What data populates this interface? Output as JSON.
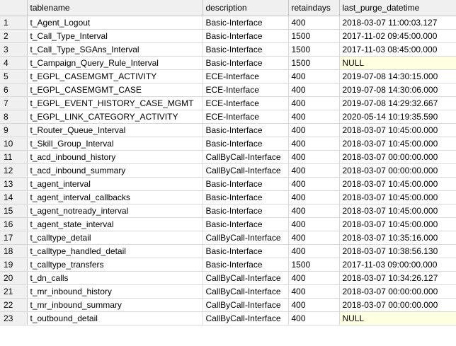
{
  "grid": {
    "columns": [
      "tablename",
      "description",
      "retaindays",
      "last_purge_datetime"
    ],
    "rows": [
      {
        "n": "1",
        "tablename": "t_Agent_Logout",
        "description": "Basic-Interface",
        "retaindays": "400",
        "last_purge_datetime": "2018-03-07 11:00:03.127"
      },
      {
        "n": "2",
        "tablename": "t_Call_Type_Interval",
        "description": "Basic-Interface",
        "retaindays": "1500",
        "last_purge_datetime": "2017-11-02 09:45:00.000"
      },
      {
        "n": "3",
        "tablename": "t_Call_Type_SGAns_Interval",
        "description": "Basic-Interface",
        "retaindays": "1500",
        "last_purge_datetime": "2017-11-03 08:45:00.000"
      },
      {
        "n": "4",
        "tablename": "t_Campaign_Query_Rule_Interval",
        "description": "Basic-Interface",
        "retaindays": "1500",
        "last_purge_datetime": "NULL"
      },
      {
        "n": "5",
        "tablename": "t_EGPL_CASEMGMT_ACTIVITY",
        "description": "ECE-Interface",
        "retaindays": "400",
        "last_purge_datetime": "2019-07-08 14:30:15.000"
      },
      {
        "n": "6",
        "tablename": "t_EGPL_CASEMGMT_CASE",
        "description": "ECE-Interface",
        "retaindays": "400",
        "last_purge_datetime": "2019-07-08 14:30:06.000"
      },
      {
        "n": "7",
        "tablename": "t_EGPL_EVENT_HISTORY_CASE_MGMT",
        "description": "ECE-Interface",
        "retaindays": "400",
        "last_purge_datetime": "2019-07-08 14:29:32.667"
      },
      {
        "n": "8",
        "tablename": "t_EGPL_LINK_CATEGORY_ACTIVITY",
        "description": "ECE-Interface",
        "retaindays": "400",
        "last_purge_datetime": "2020-05-14 10:19:35.590"
      },
      {
        "n": "9",
        "tablename": "t_Router_Queue_Interval",
        "description": "Basic-Interface",
        "retaindays": "400",
        "last_purge_datetime": "2018-03-07 10:45:00.000"
      },
      {
        "n": "10",
        "tablename": "t_Skill_Group_Interval",
        "description": "Basic-Interface",
        "retaindays": "400",
        "last_purge_datetime": "2018-03-07 10:45:00.000"
      },
      {
        "n": "11",
        "tablename": "t_acd_inbound_history",
        "description": "CallByCall-Interface",
        "retaindays": "400",
        "last_purge_datetime": "2018-03-07 00:00:00.000"
      },
      {
        "n": "12",
        "tablename": "t_acd_inbound_summary",
        "description": "CallByCall-Interface",
        "retaindays": "400",
        "last_purge_datetime": "2018-03-07 00:00:00.000"
      },
      {
        "n": "13",
        "tablename": "t_agent_interval",
        "description": "Basic-Interface",
        "retaindays": "400",
        "last_purge_datetime": "2018-03-07 10:45:00.000"
      },
      {
        "n": "14",
        "tablename": "t_agent_interval_callbacks",
        "description": "Basic-Interface",
        "retaindays": "400",
        "last_purge_datetime": "2018-03-07 10:45:00.000"
      },
      {
        "n": "15",
        "tablename": "t_agent_notready_interval",
        "description": "Basic-Interface",
        "retaindays": "400",
        "last_purge_datetime": "2018-03-07 10:45:00.000"
      },
      {
        "n": "16",
        "tablename": "t_agent_state_interval",
        "description": "Basic-Interface",
        "retaindays": "400",
        "last_purge_datetime": "2018-03-07 10:45:00.000"
      },
      {
        "n": "17",
        "tablename": "t_calltype_detail",
        "description": "CallByCall-Interface",
        "retaindays": "400",
        "last_purge_datetime": "2018-03-07 10:35:16.000"
      },
      {
        "n": "18",
        "tablename": "t_calltype_handled_detail",
        "description": "Basic-Interface",
        "retaindays": "400",
        "last_purge_datetime": "2018-03-07 10:38:56.130"
      },
      {
        "n": "19",
        "tablename": "t_calltype_transfers",
        "description": "Basic-Interface",
        "retaindays": "1500",
        "last_purge_datetime": "2017-11-03 09:00:00.000"
      },
      {
        "n": "20",
        "tablename": "t_dn_calls",
        "description": "CallByCall-Interface",
        "retaindays": "400",
        "last_purge_datetime": "2018-03-07 10:34:26.127"
      },
      {
        "n": "21",
        "tablename": "t_mr_inbound_history",
        "description": "CallByCall-Interface",
        "retaindays": "400",
        "last_purge_datetime": "2018-03-07 00:00:00.000"
      },
      {
        "n": "22",
        "tablename": "t_mr_inbound_summary",
        "description": "CallByCall-Interface",
        "retaindays": "400",
        "last_purge_datetime": "2018-03-07 00:00:00.000"
      },
      {
        "n": "23",
        "tablename": "t_outbound_detail",
        "description": "CallByCall-Interface",
        "retaindays": "400",
        "last_purge_datetime": "NULL"
      }
    ]
  },
  "colors": {
    "header_bg": "#f0f0f0",
    "null_bg": "#ffffe1",
    "gridline": "#d9d9d9"
  }
}
